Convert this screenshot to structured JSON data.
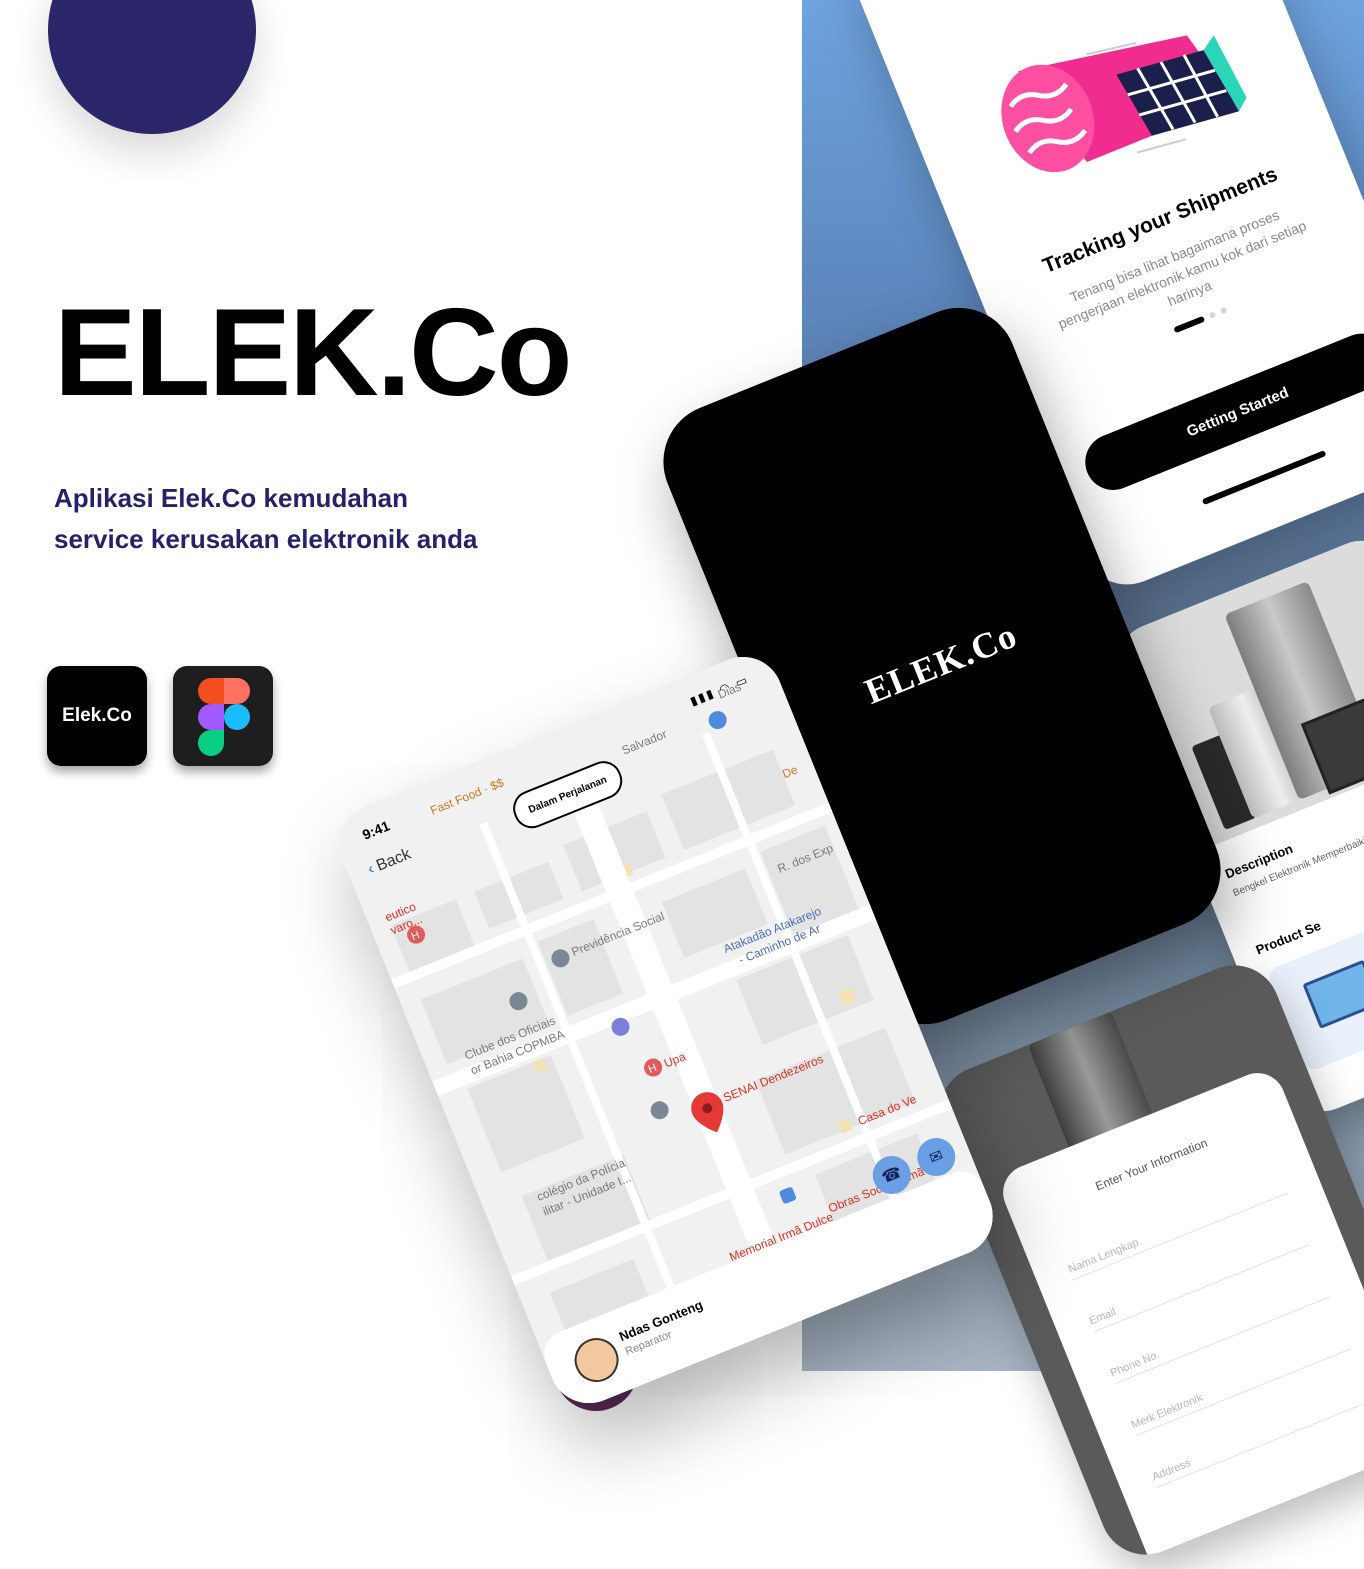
{
  "brand": {
    "title": "ELEK.Co",
    "tagline": "Aplikasi Elek.Co kemudahan service kerusakan elektronik anda",
    "app_icon_label": "Elek.Co",
    "accent_color": "#26226a"
  },
  "splash": {
    "logo_text": "ELEK.Co"
  },
  "onboarding": {
    "title": "Tracking your Shipments",
    "subtitle": "Tenang bisa lihat bagaimana proses pengerjaan elektronik kamu kok dari setiap harinya",
    "button_label": "Getting Started",
    "page_count": 3,
    "active_page": 1
  },
  "map_screen": {
    "status_time": "9:41",
    "back_label": "Back",
    "status_pill": "Dalam Perjalanan",
    "labels": {
      "fast_food": "Fast Food · $$",
      "salvador": "Salvador",
      "dias": "Dias",
      "eutico": "eutico",
      "varo": "varo...",
      "de": "De",
      "previdencia": "Previdência Social",
      "r_dos_exp": "R. dos Exp",
      "clube_line1": "Clube dos Oficiais",
      "clube_line2": "or Bahia COPMBA",
      "atakadao_line1": "Atakadão Atakarejo",
      "atakadao_line2": "- Caminho de Ar",
      "upa": "Upa",
      "senai": "SENAI Dendezeiros",
      "colegio_line1": "colégio da Polícia",
      "colegio_line2": "ilitar - Unidade I...",
      "casa": "Casa do Ve",
      "obras": "Obras Sociais Irmã",
      "memorial": "Memorial Irmã Dulce"
    },
    "driver": {
      "name": "Ndas Gonteng",
      "role": "Reparator"
    }
  },
  "detail_screen": {
    "description_heading": "Description",
    "description_text": "Bengkel Elektronik Memperbaiki Se Anda",
    "product_heading": "Product Se"
  },
  "form_screen": {
    "title": "Enter Your Information",
    "fields": [
      "Nama Lengkap",
      "Email",
      "Phone No.",
      "Merk Elektronik",
      "Address"
    ]
  },
  "icons": {
    "figma": "figma-logo-icon",
    "map_pin": "map-pin-icon",
    "hospital": "hospital-icon",
    "phone": "phone-icon",
    "chat": "chat-icon",
    "bus": "bus-stop-icon"
  }
}
